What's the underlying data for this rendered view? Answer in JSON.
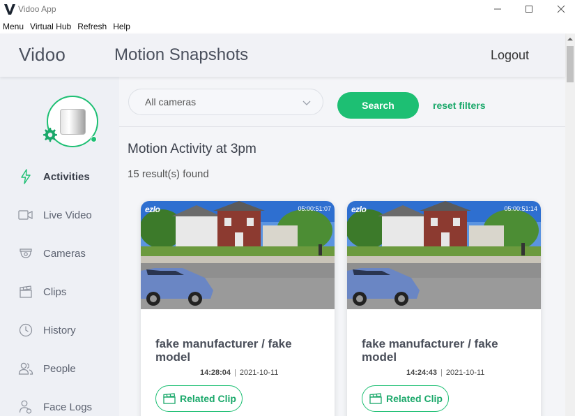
{
  "window": {
    "title": "Vidoo App"
  },
  "menu": {
    "items": [
      "Menu",
      "Virtual Hub",
      "Refresh",
      "Help"
    ]
  },
  "header": {
    "brand": "Vidoo",
    "page_title": "Motion Snapshots",
    "logout_label": "Logout"
  },
  "sidebar": {
    "items": [
      {
        "label": "Activities",
        "icon": "lightning-icon",
        "active": true
      },
      {
        "label": "Live Video",
        "icon": "video-camera-icon",
        "active": false
      },
      {
        "label": "Cameras",
        "icon": "security-camera-icon",
        "active": false
      },
      {
        "label": "Clips",
        "icon": "clapperboard-icon",
        "active": false
      },
      {
        "label": "History",
        "icon": "clock-icon",
        "active": false
      },
      {
        "label": "People",
        "icon": "people-icon",
        "active": false
      },
      {
        "label": "Face Logs",
        "icon": "face-log-icon",
        "active": false
      }
    ]
  },
  "filters": {
    "camera_select_value": "All cameras",
    "search_label": "Search",
    "reset_label": "reset filters"
  },
  "content": {
    "section_title": "Motion Activity at 3pm",
    "result_count": "15 result(s) found"
  },
  "cards": [
    {
      "watermark": "ezlo",
      "snapshot_time": "05:00:51:07",
      "name": "fake manufacturer / fake model",
      "time": "14:28:04",
      "date": "2021-10-11",
      "clip_label": "Related Clip"
    },
    {
      "watermark": "ezlo",
      "snapshot_time": "05:00:51:14",
      "name": "fake manufacturer / fake model",
      "time": "14:24:43",
      "date": "2021-10-11",
      "clip_label": "Related Clip"
    }
  ],
  "colors": {
    "accent": "#1dbf73",
    "header_bg": "#f1f2f6",
    "sidebar_bg": "#eef0f5"
  }
}
